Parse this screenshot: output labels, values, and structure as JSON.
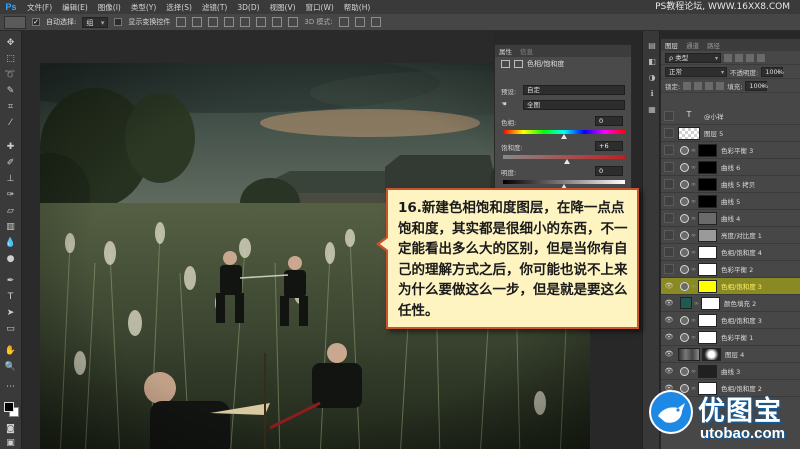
{
  "app": {
    "logo": "Ps"
  },
  "menu": [
    "文件(F)",
    "编辑(E)",
    "图像(I)",
    "类型(Y)",
    "选择(S)",
    "滤镜(T)",
    "3D(D)",
    "视图(V)",
    "窗口(W)",
    "帮助(H)"
  ],
  "watermark": "PS教程论坛, WWW.16XX8.COM",
  "options_bar": {
    "auto_select_label": "自动选择:",
    "auto_select_value": "组",
    "show_transform_label": "显示变换控件",
    "mode_3d_label": "3D 模式:"
  },
  "properties": {
    "tabs": [
      "属性",
      "信息"
    ],
    "title": "色相/饱和度",
    "preset_label": "预设:",
    "preset_value": "自定",
    "channel_value": "全图",
    "hue_label": "色相:",
    "hue_value": "0",
    "saturation_label": "饱和度:",
    "saturation_value": "+6",
    "lightness_label": "明度:",
    "lightness_value": "0"
  },
  "layers_panel": {
    "tabs": [
      "图层",
      "通道",
      "路径"
    ],
    "filter_label": "ρ 类型",
    "blend_mode": "正常",
    "opacity_label": "不透明度:",
    "opacity_value": "100%",
    "lock_label": "锁定:",
    "fill_label": "填充:",
    "fill_value": "100%",
    "layers": [
      {
        "name": "@小祥",
        "kind": "text",
        "visible": false
      },
      {
        "name": "图层 5",
        "kind": "transparent",
        "visible": false
      },
      {
        "name": "色彩平衡 3",
        "kind": "adjustment",
        "mask_color": "#000000",
        "visible": false
      },
      {
        "name": "曲线 6",
        "kind": "adjustment",
        "mask_color": "#000000",
        "visible": false
      },
      {
        "name": "曲线 5 拷贝",
        "kind": "adjustment",
        "mask_color": "#000000",
        "visible": false
      },
      {
        "name": "曲线 5",
        "kind": "adjustment",
        "mask_color": "#000000",
        "visible": false
      },
      {
        "name": "曲线 4",
        "kind": "adjustment",
        "mask_color": "#6a6a6a",
        "visible": false
      },
      {
        "name": "亮度/对比度 1",
        "kind": "adjustment",
        "mask_color": "#9a9a9a",
        "visible": false
      },
      {
        "name": "色相/饱和度 4",
        "kind": "adjustment",
        "mask_color": "#ffffff",
        "visible": false
      },
      {
        "name": "色彩平衡 2",
        "kind": "adjustment",
        "mask_color": "#ffffff",
        "visible": false
      },
      {
        "name": "色相/饱和度 3",
        "kind": "adjustment",
        "mask_color": "#ffff00",
        "visible": true,
        "selected": true
      },
      {
        "name": "颜色填充 2",
        "kind": "fill",
        "mask_color": "#ffffff",
        "fill_color": "#1f5a50",
        "visible": true
      },
      {
        "name": "色相/饱和度 3",
        "kind": "adjustment",
        "mask_color": "#ffffff",
        "visible": true
      },
      {
        "name": "色彩平衡 1",
        "kind": "adjustment",
        "mask_color": "#ffffff",
        "visible": true
      },
      {
        "name": "图层 4",
        "kind": "image",
        "visible": true
      },
      {
        "name": "曲线 3",
        "kind": "adjustment",
        "mask_color": "#202020",
        "visible": true
      },
      {
        "name": "色相/饱和度 2",
        "kind": "adjustment",
        "mask_color": "#ffffff",
        "visible": true
      }
    ]
  },
  "callout": {
    "text": "16.新建色相饱和度图层，在降一点点饱和度，其实都是很细小的东西，不一定能看出多么大的区别，但是当你有自己的理解方式之后，你可能也说不上来为什么要做这么一步，但是就是要这么任性。"
  },
  "logo": {
    "name": "优图宝",
    "domain": "utobao.com"
  },
  "colors": {
    "accent_logo": "#1e88e5",
    "callout_border": "#c9552f",
    "callout_bg": "#fdf4c2",
    "selected_layer": "#8a8a24"
  }
}
